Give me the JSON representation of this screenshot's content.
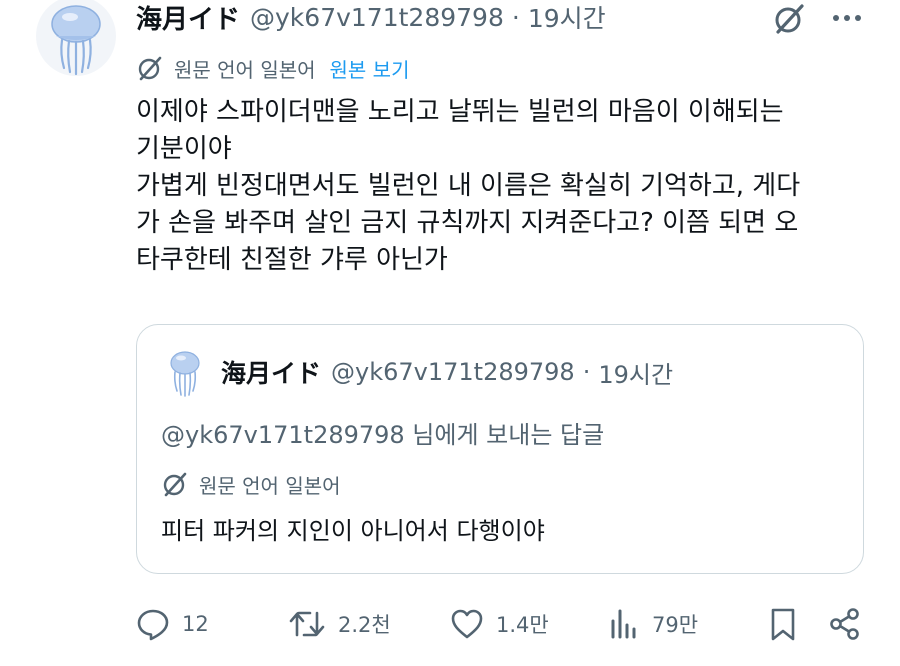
{
  "tweet": {
    "author_name": "海月イド",
    "handle": "@yk67v171t289798",
    "separator": "·",
    "time": "19시간",
    "translation_label": "원문 언어 일본어",
    "show_original": "원본 보기",
    "body_lines": [
      "이제야 스파이더맨을 노리고 날뛰는 빌런의 마음이 이해되는",
      "기분이야",
      "가볍게 빈정대면서도 빌런인 내 이름은 확실히 기억하고, 게다",
      "가 손을 봐주며 살인 금지 규칙까지 지켜준다고? 이쯤 되면 오",
      "타쿠한테 친절한 갸루 아닌가"
    ]
  },
  "quoted": {
    "author_name": "海月イド",
    "handle": "@yk67v171t289798",
    "separator": "·",
    "time": "19시간",
    "reply_to": "@yk67v171t289798 님에게 보내는 답글",
    "translation_label": "원문 언어 일본어",
    "text": "피터 파커의 지인이 아니어서 다행이야"
  },
  "actions": {
    "replies": "12",
    "reposts": "2.2천",
    "likes": "1.4만",
    "views": "79만"
  },
  "icons": [
    "jellyfish-avatar",
    "grok-icon",
    "more-icon",
    "translate-icon",
    "reply-icon",
    "repost-icon",
    "like-icon",
    "views-icon",
    "bookmark-icon",
    "share-icon"
  ],
  "colors": {
    "text": "#0f1419",
    "secondary": "#536471",
    "link": "#1d9bf0",
    "border": "#cfd9de",
    "avatar": "#a9c4ec"
  }
}
